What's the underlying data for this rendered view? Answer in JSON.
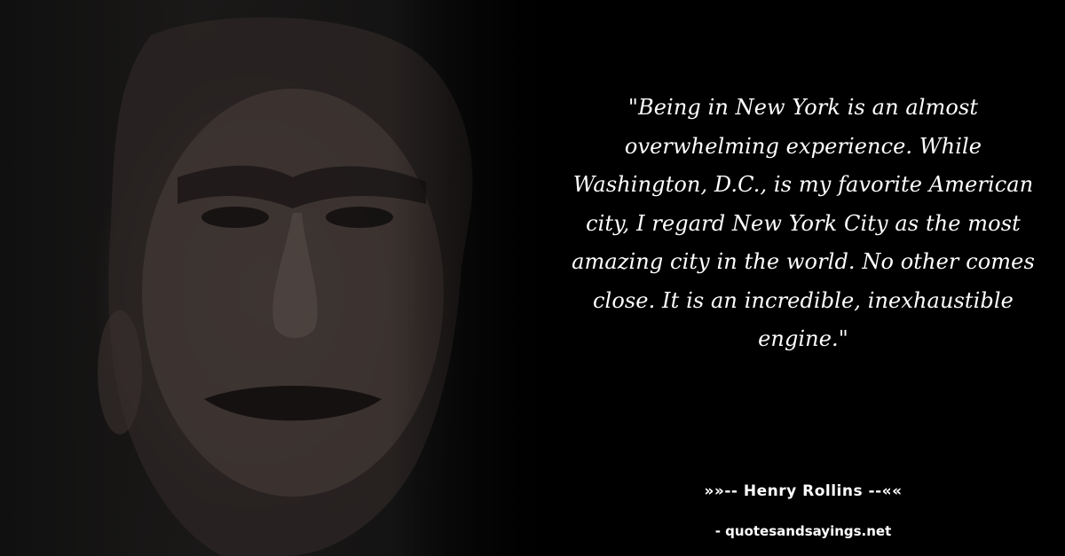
{
  "quote": {
    "text": "\"Being in New York is an almost overwhelming experience. While Washington, D.C., is my favorite American city, I regard New York City as the most amazing city in the world. No other comes close. It is an incredible, inexhaustible engine.\""
  },
  "author": {
    "line": "»»-- Henry Rollins --««"
  },
  "source": {
    "site": "- quotesandsayings.net"
  },
  "colors": {
    "background": "#000000",
    "text": "#ffffff"
  }
}
